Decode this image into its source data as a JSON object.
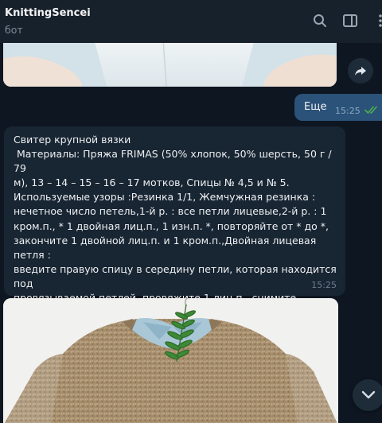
{
  "header": {
    "title": "KnittingSencei",
    "subtitle": "бот",
    "icons": [
      "search-icon",
      "sidebar-toggle-icon",
      "more-vertical-icon"
    ]
  },
  "messages": {
    "outgoing": {
      "text": "Еще",
      "time": "15:25",
      "status_icon": "double-check-icon"
    },
    "incoming": {
      "text": "Свитер крупной вязки\n Материалы: Пряжа FRIMAS (50% хлопок, 50% шерсть, 50 г / 79\nм), 13 – 14 – 15 – 16 – 17 мотков, Спицы № 4,5 и № 5.\nИспользуемые узоры :Резинка 1/1, Жемчужная резинка :\nнечетное число петель,1-й р. : все петли лицевые,2-й р. : 1\nкром.п., * 1 двойная лиц.п., 1 изн.п. *, повторяйте от * до *,\nзакончите 1 двойной лиц.п. и 1 кром.п.,Двойная лицевая петля :\nвведите правую спицу в середину петли, которая находится под\nпровязываемой петлей, провяжите 1 лиц.п., снимите\nполученную лиц.п. с левой спицы,Изнаночная\nгладь,Фантазийный узор. Вязание частями.",
      "time": "15:25"
    }
  },
  "colors": {
    "background": "#0e1621",
    "header": "#17212b",
    "incoming_bubble": "#182533",
    "outgoing_bubble": "#2b5278",
    "check_color": "#4fae4e"
  }
}
